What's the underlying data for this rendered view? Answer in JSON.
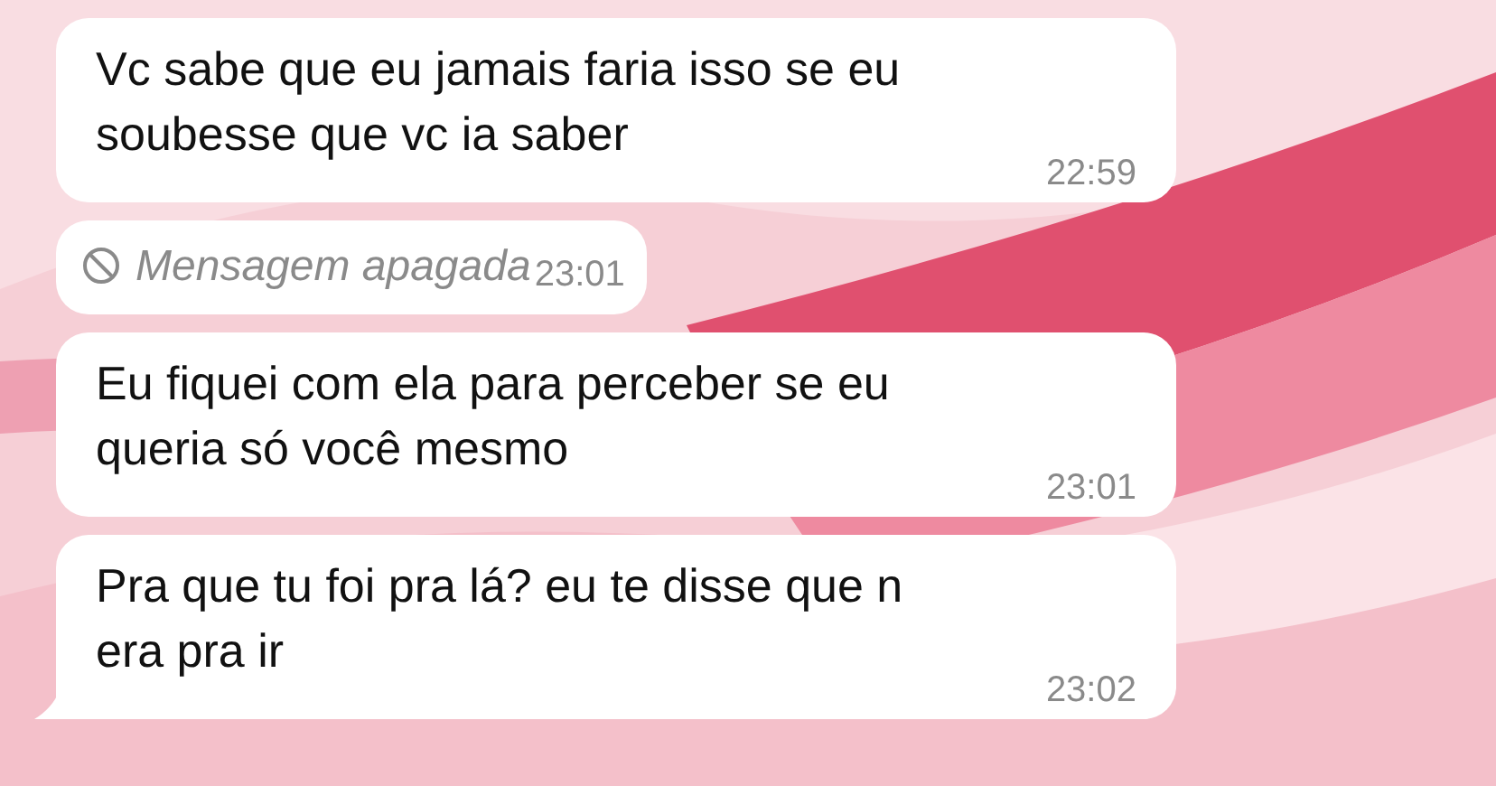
{
  "messages": [
    {
      "kind": "text",
      "text": "Vc sabe que eu jamais faria isso se eu\nsoubesse que vc ia saber",
      "time": "22:59",
      "tail": false
    },
    {
      "kind": "deleted",
      "text": "Mensagem apagada",
      "time": "23:01",
      "tail": false
    },
    {
      "kind": "text",
      "text": "Eu fiquei com ela para perceber se eu\nqueria só você mesmo",
      "time": "23:01",
      "tail": false
    },
    {
      "kind": "text",
      "text": "Pra que tu foi pra lá? eu te disse que n\nera pra ir",
      "time": "23:02",
      "tail": true
    }
  ]
}
